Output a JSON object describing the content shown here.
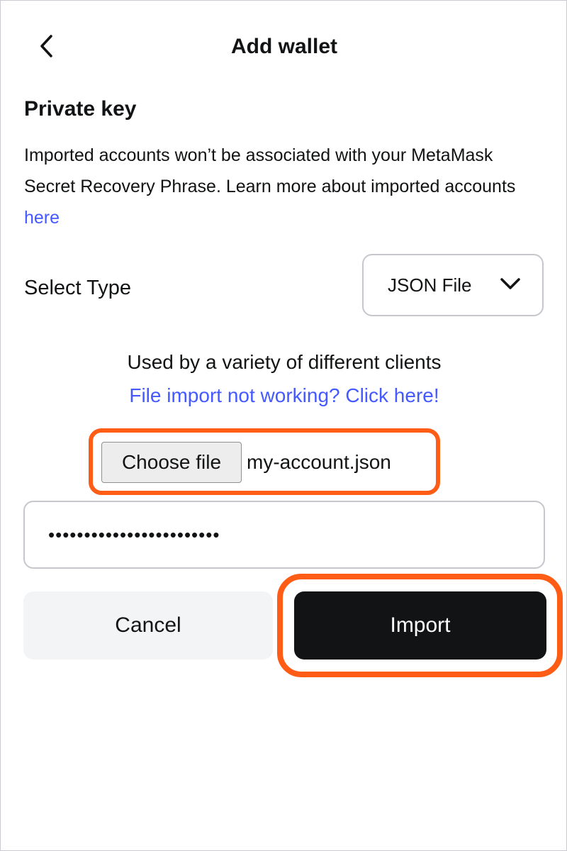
{
  "header": {
    "title": "Add wallet",
    "back_icon": "chevron-left-icon"
  },
  "section": {
    "title": "Private key",
    "description_text": "Imported accounts won’t be associated with your MetaMask Secret Recovery Phrase. Learn more about imported accounts ",
    "description_link": "here"
  },
  "select_type": {
    "label": "Select Type",
    "value": "JSON File",
    "icon": "chevron-down-icon"
  },
  "info": {
    "text": "Used by a variety of different clients",
    "help_link": "File import not working? Click here!"
  },
  "file_input": {
    "button_label": "Choose file",
    "file_name": "my-account.json"
  },
  "password": {
    "value": "••••••••••••••••••••••••"
  },
  "actions": {
    "cancel_label": "Cancel",
    "import_label": "Import"
  },
  "colors": {
    "link": "#4459ff",
    "highlight": "#ff5c16",
    "primary_button": "#121314",
    "secondary_button": "#f3f4f6"
  }
}
